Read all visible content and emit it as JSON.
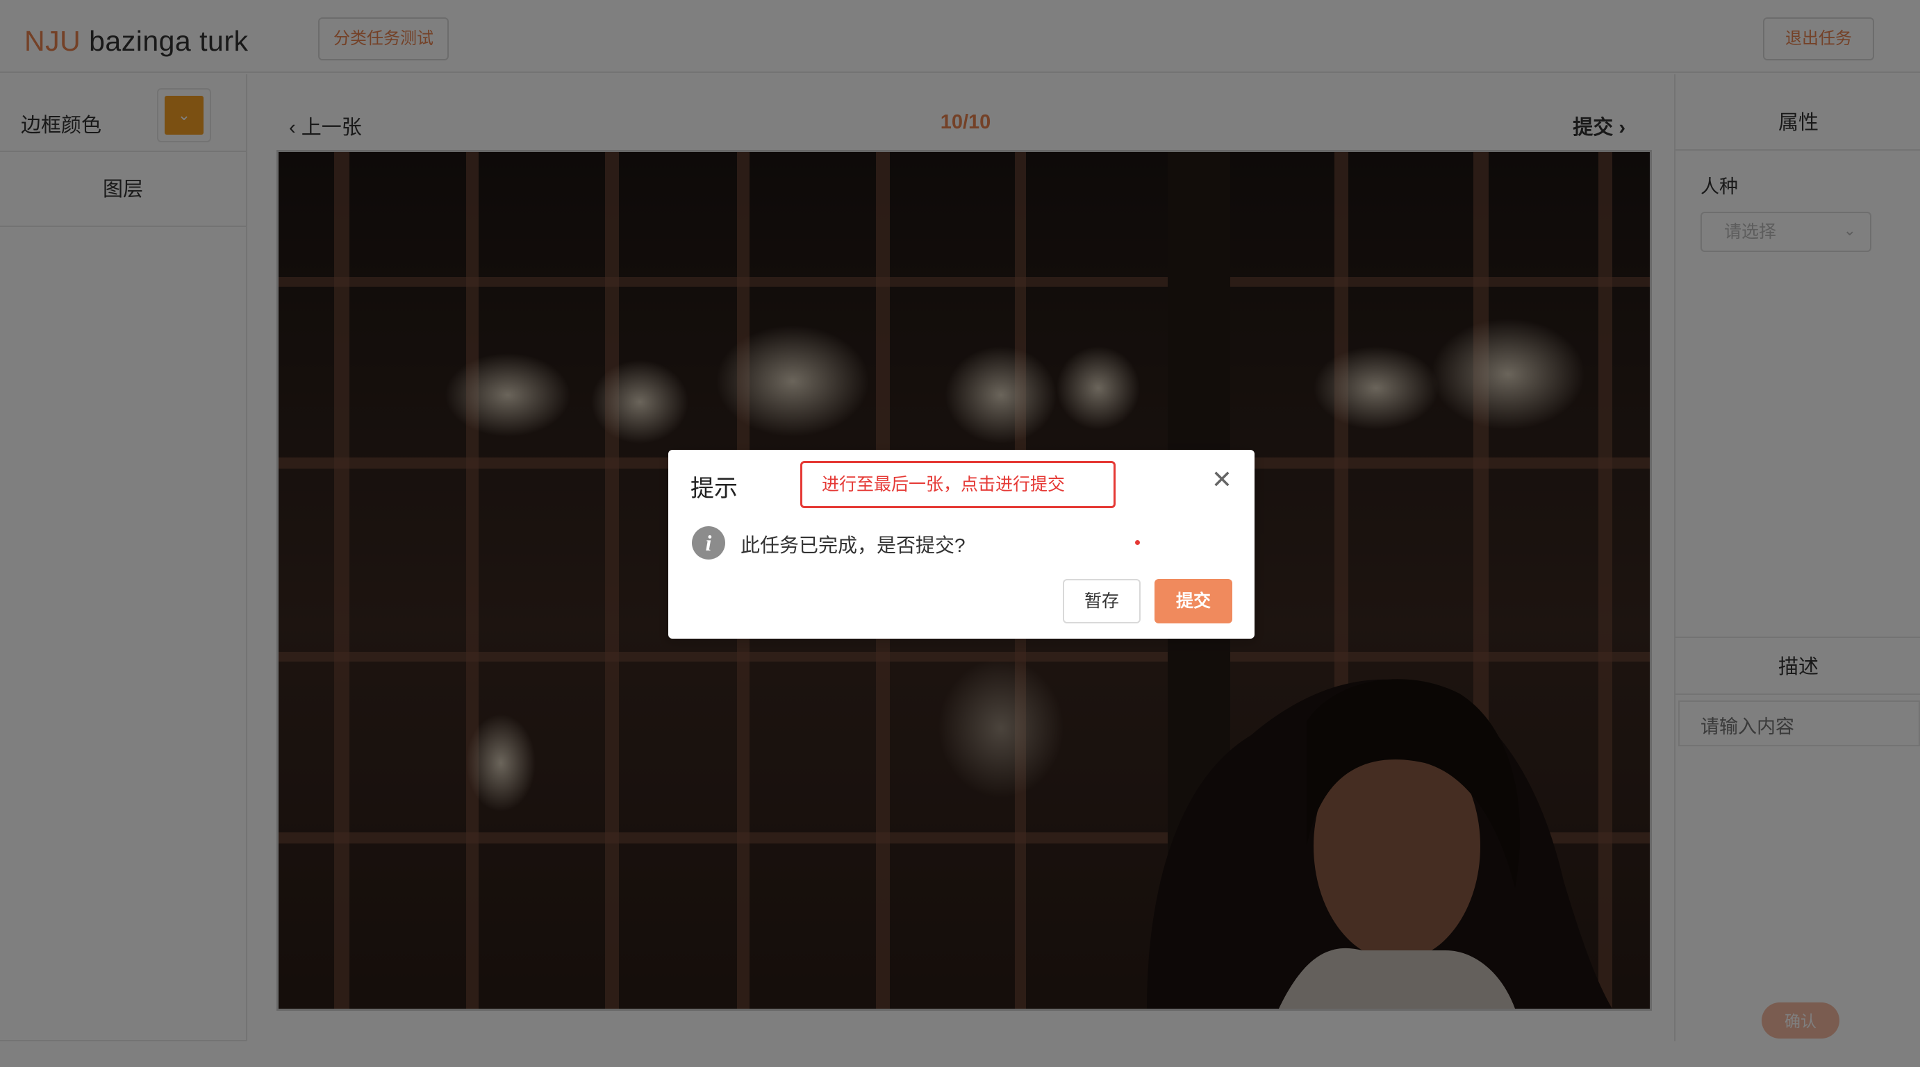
{
  "header": {
    "brand_accent": "NJU",
    "brand_rest": " bazinga turk",
    "task_tag": "分类任务测试",
    "exit_button": "退出任务"
  },
  "left_panel": {
    "border_color_label": "边框颜色",
    "border_color_value": "#f7a124",
    "layers_title": "图层"
  },
  "navigation": {
    "prev_label": "上一张",
    "page_counter": "10/10",
    "next_label": "提交"
  },
  "image": {
    "description_icon": "photo-of-woman-in-dark-office"
  },
  "right_panel": {
    "attributes_title": "属性",
    "race_label": "人种",
    "race_select_placeholder": "请选择",
    "description_title": "描述",
    "description_placeholder": "请输入内容",
    "confirm_button": "确认"
  },
  "modal": {
    "title": "提示",
    "annotation": "进行至最后一张，点击进行提交",
    "message": "此任务已完成，是否提交?",
    "save_button": "暂存",
    "submit_button": "提交"
  },
  "colors": {
    "accent": "#e8834f",
    "primary_button": "#f08a5d",
    "annotation_red": "#e53935"
  }
}
